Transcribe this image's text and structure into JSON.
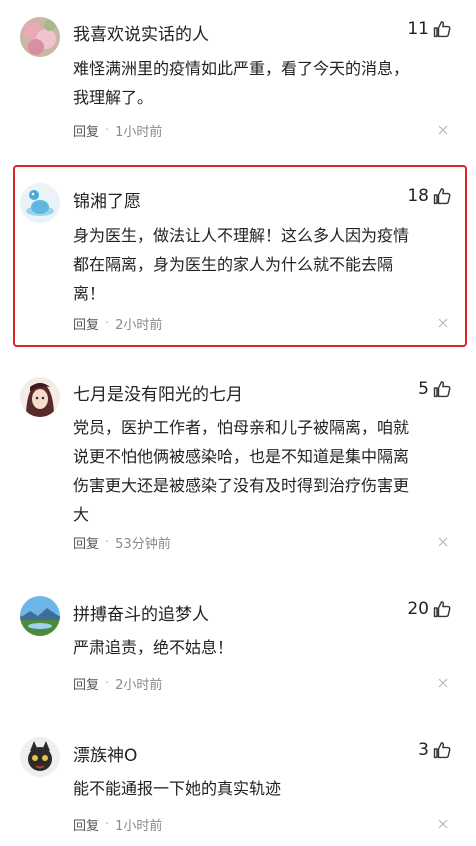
{
  "comments": [
    {
      "user": "我喜欢说实话的人",
      "likes": "11",
      "text": "难怪满洲里的疫情如此严重，看了今天的消息，\n我理解了。",
      "reply": "回复",
      "dot": "·",
      "time": "1小时前"
    },
    {
      "user": "锦湘了愿",
      "likes": "18",
      "text": "身为医生，做法让人不理解！这么多人因为疫情\n都在隔离，身为医生的家人为什么就不能去隔\n离！",
      "reply": "回复",
      "dot": "·",
      "time": "2小时前"
    },
    {
      "user": "七月是没有阳光的七月",
      "likes": "5",
      "text": "党员，医护工作者，怕母亲和儿子被隔离，咱就\n说更不怕他俩被感染哈，也是不知道是集中隔离\n伤害更大还是被感染了没有及时得到治疗伤害更\n大",
      "reply": "回复",
      "dot": "·",
      "time": "53分钟前"
    },
    {
      "user": "拼搏奋斗的追梦人",
      "likes": "20",
      "text": "严肃追责，绝不姑息！",
      "reply": "回复",
      "dot": "·",
      "time": "2小时前"
    },
    {
      "user": "漂族神O",
      "likes": "3",
      "text": "能不能通报一下她的真实轨迹",
      "reply": "回复",
      "dot": "·",
      "time": "1小时前"
    }
  ],
  "colors": {
    "highlight_border": "#e0242b",
    "meta_text": "#8a8a8a"
  }
}
